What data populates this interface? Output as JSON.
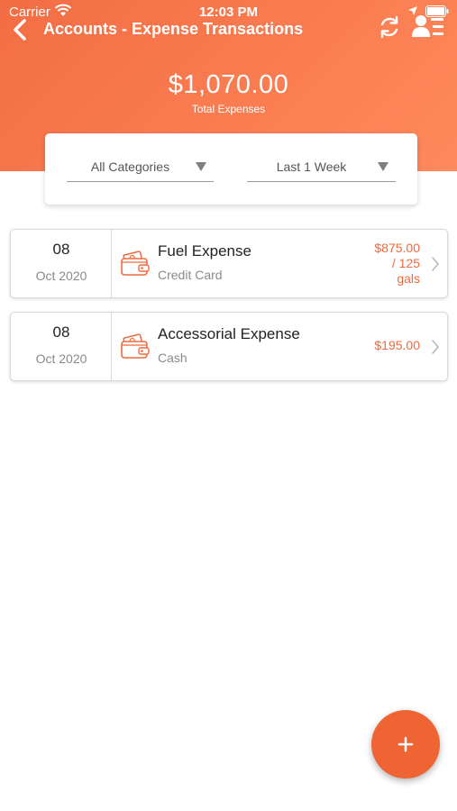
{
  "status_bar": {
    "carrier": "Carrier",
    "time": "12:03 PM"
  },
  "header": {
    "title": "Accounts - Expense Transactions",
    "total_amount": "$1,070.00",
    "total_label": "Total Expenses",
    "icons": {
      "back": "chevron-left-icon",
      "refresh": "refresh-icon",
      "profile": "user-list-icon"
    }
  },
  "filters": {
    "category": "All Categories",
    "period": "Last 1 Week"
  },
  "transactions": [
    {
      "day": "08",
      "month_year": "Oct 2020",
      "name": "Fuel Expense",
      "method": "Credit Card",
      "amount_line1": "$875.00",
      "amount_line2": "/ 125",
      "amount_line3": "gals"
    },
    {
      "day": "08",
      "month_year": "Oct 2020",
      "name": "Accessorial Expense",
      "method": "Cash",
      "amount_line1": "$195.00"
    }
  ],
  "colors": {
    "header_gradient_start": "#f36d44",
    "header_gradient_end": "#ff8a5c",
    "accent": "#ee6a3f",
    "fab": "#ef6433"
  },
  "fab": {
    "icon": "plus-icon"
  }
}
